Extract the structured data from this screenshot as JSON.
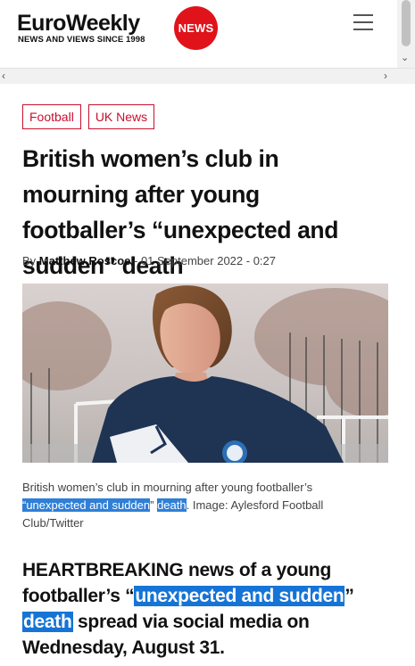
{
  "header": {
    "logo_word": "EuroWeekly",
    "logo_badge": "NEWS",
    "tagline": "NEWS AND VIEWS SINCE 1998",
    "menu_icon": "hamburger-menu-icon"
  },
  "scrollbar": {
    "left_arrow": "‹",
    "right_arrow": "›",
    "down_arrow": "⌄"
  },
  "tags": [
    {
      "label": "Football"
    },
    {
      "label": "UK News"
    }
  ],
  "article": {
    "headline": "British women’s club in mourning after young footballer’s “unexpected and sudden” death",
    "by": "By",
    "author": "Matthew Roscoe",
    "date_sep": " - ",
    "date": "01 September 2022",
    "time_sep": " - ",
    "time": "0:27",
    "caption_pre": "British women’s club in mourning after young footballer’s ",
    "caption_hl1": "“unexpected and sudden",
    "caption_mid": "” ",
    "caption_hl2": "death",
    "caption_post": ". Image: Aylesford Football Club/Twitter",
    "lead_pre": "HEARTBREAKING news of a young footballer’s “",
    "lead_hl1": "unexpected and sudden",
    "lead_mid": "” ",
    "lead_hl2": "death",
    "lead_post": " spread via social media on Wednesday, August 31."
  },
  "colors": {
    "brand_red": "#e0131a",
    "tag_red": "#c8102e",
    "highlight_blue": "#1574d6"
  }
}
